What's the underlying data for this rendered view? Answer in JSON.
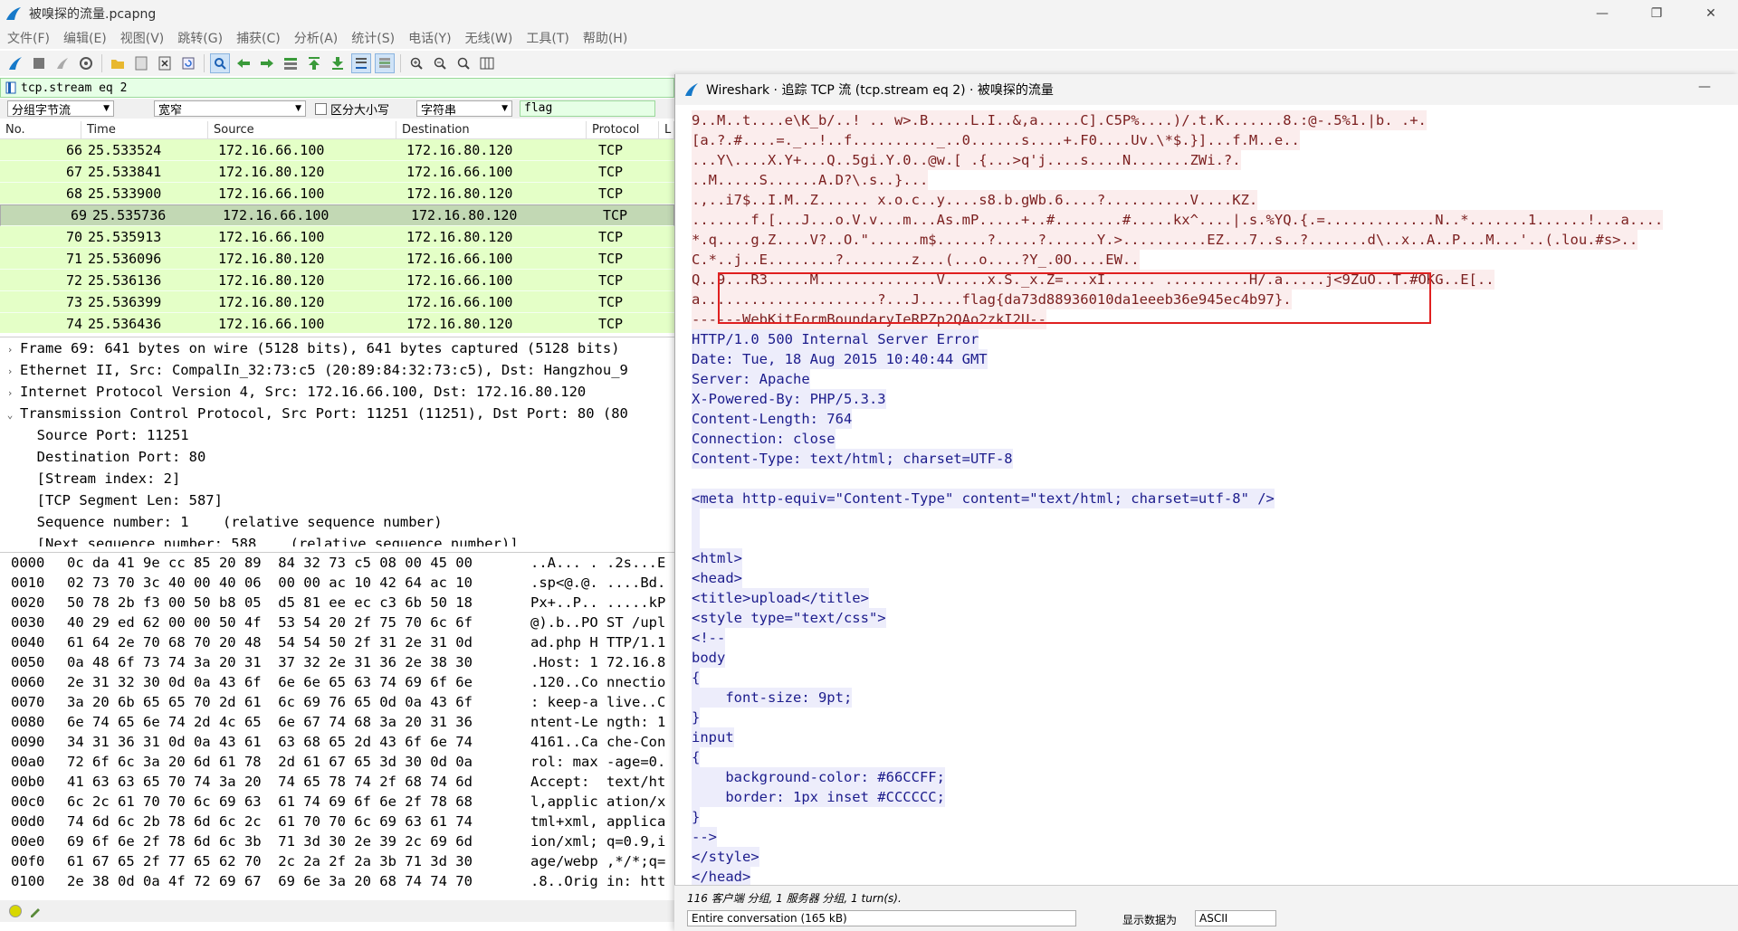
{
  "window": {
    "title": "被嗅探的流量.pcapng",
    "min": "—",
    "max": "❐",
    "close": "✕"
  },
  "menu": [
    "文件(F)",
    "编辑(E)",
    "视图(V)",
    "跳转(G)",
    "捕获(C)",
    "分析(A)",
    "统计(S)",
    "电话(Y)",
    "无线(W)",
    "工具(T)",
    "帮助(H)"
  ],
  "filter": {
    "value": "tcp.stream eq 2"
  },
  "search": {
    "scope": "分组字节流",
    "width_mode": "宽窄",
    "case_label": "区分大小写",
    "type": "字符串",
    "value": "flag"
  },
  "packet_list": {
    "headers": [
      "No.",
      "Time",
      "Source",
      "Destination",
      "Protocol",
      "L"
    ],
    "rows": [
      {
        "no": "66",
        "time": "25.533524",
        "src": "172.16.66.100",
        "dst": "172.16.80.120",
        "proto": "TCP",
        "selected": false
      },
      {
        "no": "67",
        "time": "25.533841",
        "src": "172.16.80.120",
        "dst": "172.16.66.100",
        "proto": "TCP",
        "selected": false
      },
      {
        "no": "68",
        "time": "25.533900",
        "src": "172.16.66.100",
        "dst": "172.16.80.120",
        "proto": "TCP",
        "selected": false
      },
      {
        "no": "69",
        "time": "25.535736",
        "src": "172.16.66.100",
        "dst": "172.16.80.120",
        "proto": "TCP",
        "selected": true
      },
      {
        "no": "70",
        "time": "25.535913",
        "src": "172.16.66.100",
        "dst": "172.16.80.120",
        "proto": "TCP",
        "selected": false
      },
      {
        "no": "71",
        "time": "25.536096",
        "src": "172.16.80.120",
        "dst": "172.16.66.100",
        "proto": "TCP",
        "selected": false
      },
      {
        "no": "72",
        "time": "25.536136",
        "src": "172.16.80.120",
        "dst": "172.16.66.100",
        "proto": "TCP",
        "selected": false
      },
      {
        "no": "73",
        "time": "25.536399",
        "src": "172.16.80.120",
        "dst": "172.16.66.100",
        "proto": "TCP",
        "selected": false
      },
      {
        "no": "74",
        "time": "25.536436",
        "src": "172.16.66.100",
        "dst": "172.16.80.120",
        "proto": "TCP",
        "selected": false
      }
    ]
  },
  "details": [
    {
      "exp": "›",
      "text": "Frame 69: 641 bytes on wire (5128 bits), 641 bytes captured (5128 bits)"
    },
    {
      "exp": "›",
      "text": "Ethernet II, Src: CompalIn_32:73:c5 (20:89:84:32:73:c5), Dst: Hangzhou_9"
    },
    {
      "exp": "›",
      "text": "Internet Protocol Version 4, Src: 172.16.66.100, Dst: 172.16.80.120"
    },
    {
      "exp": "⌄",
      "text": "Transmission Control Protocol, Src Port: 11251 (11251), Dst Port: 80 (80"
    },
    {
      "exp": "",
      "text": "  Source Port: 11251"
    },
    {
      "exp": "",
      "text": "  Destination Port: 80"
    },
    {
      "exp": "",
      "text": "  [Stream index: 2]"
    },
    {
      "exp": "",
      "text": "  [TCP Segment Len: 587]"
    },
    {
      "exp": "",
      "text": "  Sequence number: 1    (relative sequence number)"
    },
    {
      "exp": "",
      "text": "  [Next sequence number: 588    (relative sequence number)]"
    }
  ],
  "bytes": [
    {
      "off": "0000",
      "hex": "0c da 41 9e cc 85 20 89  84 32 73 c5 08 00 45 00",
      "asc": "..A... . .2s...E"
    },
    {
      "off": "0010",
      "hex": "02 73 70 3c 40 00 40 06  00 00 ac 10 42 64 ac 10",
      "asc": ".sp<@.@. ....Bd."
    },
    {
      "off": "0020",
      "hex": "50 78 2b f3 00 50 b8 05  d5 81 ee ec c3 6b 50 18",
      "asc": "Px+..P.. .....kP"
    },
    {
      "off": "0030",
      "hex": "40 29 ed 62 00 00 50 4f  53 54 20 2f 75 70 6c 6f",
      "asc": "@).b..PO ST /upl"
    },
    {
      "off": "0040",
      "hex": "61 64 2e 70 68 70 20 48  54 54 50 2f 31 2e 31 0d",
      "asc": "ad.php H TTP/1.1"
    },
    {
      "off": "0050",
      "hex": "0a 48 6f 73 74 3a 20 31  37 32 2e 31 36 2e 38 30",
      "asc": ".Host: 1 72.16.8"
    },
    {
      "off": "0060",
      "hex": "2e 31 32 30 0d 0a 43 6f  6e 6e 65 63 74 69 6f 6e",
      "asc": ".120..Co nnectio"
    },
    {
      "off": "0070",
      "hex": "3a 20 6b 65 65 70 2d 61  6c 69 76 65 0d 0a 43 6f",
      "asc": ": keep-a live..C"
    },
    {
      "off": "0080",
      "hex": "6e 74 65 6e 74 2d 4c 65  6e 67 74 68 3a 20 31 36",
      "asc": "ntent-Le ngth: 1"
    },
    {
      "off": "0090",
      "hex": "34 31 36 31 0d 0a 43 61  63 68 65 2d 43 6f 6e 74",
      "asc": "4161..Ca che-Con"
    },
    {
      "off": "00a0",
      "hex": "72 6f 6c 3a 20 6d 61 78  2d 61 67 65 3d 30 0d 0a",
      "asc": "rol: max -age=0."
    },
    {
      "off": "00b0",
      "hex": "41 63 63 65 70 74 3a 20  74 65 78 74 2f 68 74 6d",
      "asc": "Accept:  text/ht"
    },
    {
      "off": "00c0",
      "hex": "6c 2c 61 70 70 6c 69 63  61 74 69 6f 6e 2f 78 68",
      "asc": "l,applic ation/x"
    },
    {
      "off": "00d0",
      "hex": "74 6d 6c 2b 78 6d 6c 2c  61 70 70 6c 69 63 61 74",
      "asc": "tml+xml, applica"
    },
    {
      "off": "00e0",
      "hex": "69 6f 6e 2f 78 6d 6c 3b  71 3d 30 2e 39 2c 69 6d",
      "asc": "ion/xml; q=0.9,i"
    },
    {
      "off": "00f0",
      "hex": "61 67 65 2f 77 65 62 70  2c 2a 2f 2a 3b 71 3d 30",
      "asc": "age/webp ,*/*;q="
    },
    {
      "off": "0100",
      "hex": "2e 38 0d 0a 4f 72 69 67  69 6e 3a 20 68 74 74 70",
      "asc": ".8..Orig in: htt"
    }
  ],
  "tcp_window": {
    "title": "Wireshark · 追踪 TCP 流 (tcp.stream eq 2) · 被嗅探的流量",
    "min": "—",
    "lines": [
      {
        "dir": "c",
        "text": "9..M..t....e\\K_b/..! .. w>.B.....L.I..&,a.....C].C5P%....)/.t.K.......8.:@-.5%1.|b. .+."
      },
      {
        "dir": "c",
        "text": "[a.?.#....=._..!..f.........._..0......s....+.F0....Uv.\\*$.}]...f.M..e.."
      },
      {
        "dir": "c",
        "text": "...Y\\....X.Y+...Q..5gi.Y.0..@w.[ .{...>q'j....s....N.......ZWi.?."
      },
      {
        "dir": "c",
        "text": "..M.....S......A.D?\\.s..}..."
      },
      {
        "dir": "c",
        "text": ".,..i7$..I.M..Z...... x.o.c..y....s8.b.gWb.6....?..........V....KZ."
      },
      {
        "dir": "c",
        "text": ".......f.[...J...o.V.v...m...As.mP.....+..#........#.....kx^....|.s.%YQ.{.=.............N..*.......1......!...a...."
      },
      {
        "dir": "c",
        "text": "*.q....g.Z....V?..O.\"......m$......?.....?......Y.>..........EZ...7..s..?.......d\\..x..A..P...M...'..(.lou.#s>.."
      },
      {
        "dir": "c",
        "text": "C.*..j..E........?........z...(...o....?Y_.0O....EW.."
      },
      {
        "dir": "c",
        "text": "Q..9...R3.....M..............V.....x.S._x.Z=...xI...... ..........H/.a.....j<9ZuO..T.#OKG..E[.."
      },
      {
        "dir": "c",
        "text": "a.....................?...J.....flag{da73d88936010da1eeeb36e945ec4b97}."
      },
      {
        "dir": "c",
        "text": "------WebKitFormBoundaryIeRPZp2QAo2zkI2U--"
      },
      {
        "dir": "s",
        "text": "HTTP/1.0 500 Internal Server Error"
      },
      {
        "dir": "s",
        "text": "Date: Tue, 18 Aug 2015 10:40:44 GMT"
      },
      {
        "dir": "s",
        "text": "Server: Apache"
      },
      {
        "dir": "s",
        "text": "X-Powered-By: PHP/5.3.3"
      },
      {
        "dir": "s",
        "text": "Content-Length: 764"
      },
      {
        "dir": "s",
        "text": "Connection: close"
      },
      {
        "dir": "s",
        "text": "Content-Type: text/html; charset=UTF-8"
      },
      {
        "dir": "s",
        "text": ""
      },
      {
        "dir": "s",
        "text": "<meta http-equiv=\"Content-Type\" content=\"text/html; charset=utf-8\" />"
      },
      {
        "dir": "s",
        "text": " "
      },
      {
        "dir": "s",
        "text": " "
      },
      {
        "dir": "s",
        "text": "<html>"
      },
      {
        "dir": "s",
        "text": "<head>"
      },
      {
        "dir": "s",
        "text": "<title>upload</title>"
      },
      {
        "dir": "s",
        "text": "<style type=\"text/css\">"
      },
      {
        "dir": "s",
        "text": "<!--"
      },
      {
        "dir": "s",
        "text": "body"
      },
      {
        "dir": "s",
        "text": "{"
      },
      {
        "dir": "s",
        "text": "    font-size: 9pt;"
      },
      {
        "dir": "s",
        "text": "}"
      },
      {
        "dir": "s",
        "text": "input"
      },
      {
        "dir": "s",
        "text": "{"
      },
      {
        "dir": "s",
        "text": "    background-color: #66CCFF;"
      },
      {
        "dir": "s",
        "text": "    border: 1px inset #CCCCCC;"
      },
      {
        "dir": "s",
        "text": "}"
      },
      {
        "dir": "s",
        "text": "-->"
      },
      {
        "dir": "s",
        "text": "</style>"
      },
      {
        "dir": "s",
        "text": "</head>"
      }
    ],
    "footer_info": "116 客户端 分组, 1 服务器 分组, 1 turn(s).",
    "conversation": "Entire conversation (165 kB)",
    "show_label": "显示数据为",
    "show_as": "ASCII"
  },
  "colors": {
    "packet_bg": "#e4ffc7",
    "packet_selected": "#c2d8b4",
    "client_text": "#7b1f1f",
    "server_text": "#1c1c8c",
    "highlight_box": "#e02020"
  }
}
